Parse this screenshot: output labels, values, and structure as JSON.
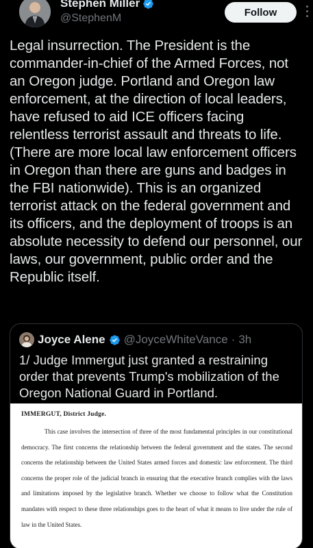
{
  "author": {
    "display_name": "Stephen Miller",
    "handle": "@StephenM",
    "follow_label": "Follow"
  },
  "post": {
    "text": "Legal insurrection. The President is the commander-in-chief of the Armed Forces, not an Oregon judge. Portland and Oregon law enforcement, at the direction of local leaders, have refused to aid ICE officers facing relentless terrorist assault and threats to life. (There are more local law enforcement officers in Oregon than there are guns and badges in the FBI nationwide). This is an organized terrorist attack on the federal government and its officers, and the deployment of troops is an absolute necessity to defend our personnel, our laws, our government, public order and the Republic itself."
  },
  "quote": {
    "display_name": "Joyce Alene",
    "handle": "@JoyceWhiteVance",
    "separator": "·",
    "time": "3h",
    "text": "1/ Judge Immergut just granted a restraining order that prevents Trump's mobilization of the Oregon National Guard in Portland.",
    "image": {
      "heading": "IMMERGUT, District Judge.",
      "paragraph": "This case involves the intersection of three of the most fundamental principles in our constitutional democracy. The first concerns the relationship between the federal government and the states. The second concerns the relationship between the United States armed forces and domestic law enforcement. The third concerns the proper role of the judicial branch in ensuring that the executive branch complies with the laws and limitations imposed by the legislative branch. Whether we choose to follow what the Constitution mandates with respect to these three relationships goes to the heart of what it means to live under the rule of law in the United States."
    }
  },
  "icons": {
    "verified": "verified-badge-icon",
    "more": "more-options-icon"
  },
  "colors": {
    "background": "#000000",
    "text": "#e7e9ea",
    "muted": "#71767b",
    "verified": "#1d9bf0",
    "border": "#2f3336",
    "follow_bg": "#eff3f4"
  }
}
